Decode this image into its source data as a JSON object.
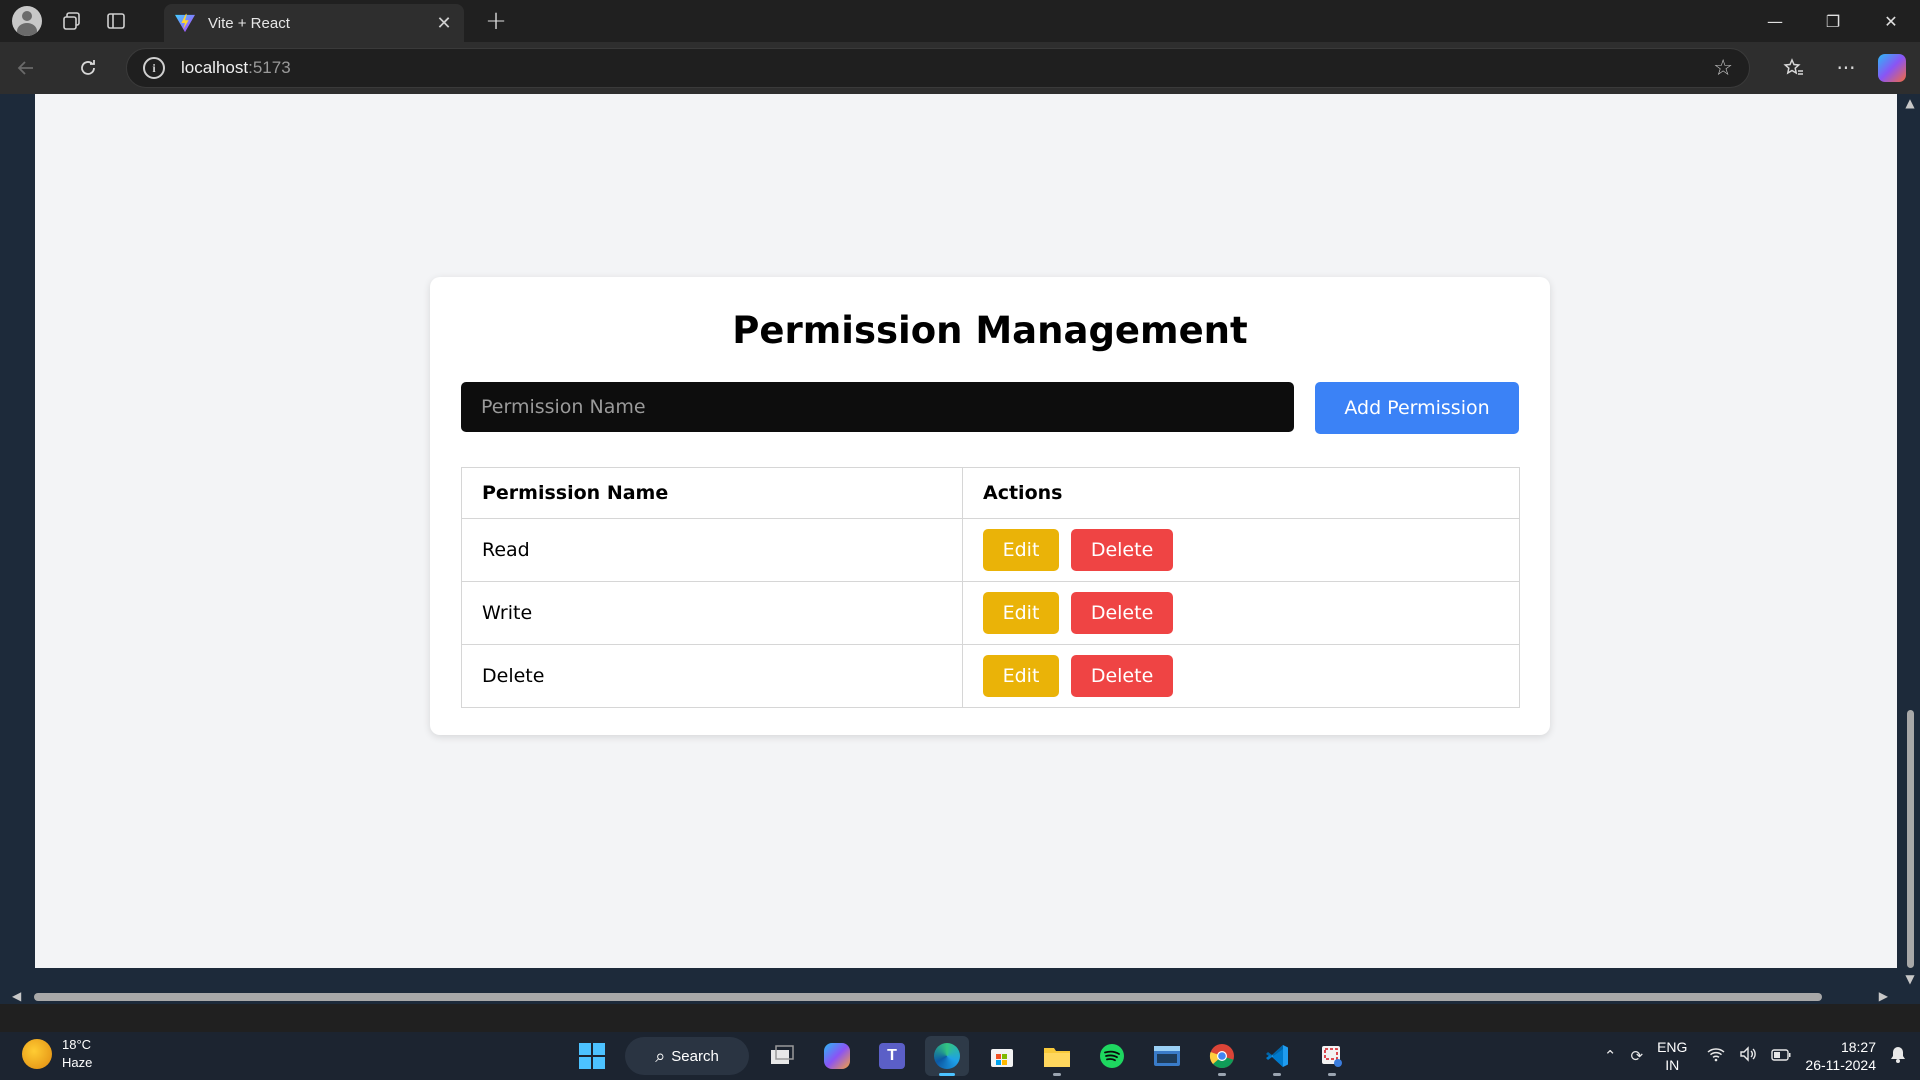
{
  "browser": {
    "tab_title": "Vite + React",
    "tab_close": "✕",
    "new_tab": "+",
    "url_host": "localhost",
    "url_port": ":5173",
    "window_controls": {
      "minimize": "—",
      "restore": "❐",
      "close": "✕"
    }
  },
  "app": {
    "title": "Permission Management",
    "input": {
      "placeholder": "Permission Name",
      "value": ""
    },
    "add_button": "Add Permission",
    "table": {
      "headers": [
        "Permission Name",
        "Actions"
      ],
      "rows": [
        {
          "name": "Read",
          "edit": "Edit",
          "delete": "Delete"
        },
        {
          "name": "Write",
          "edit": "Edit",
          "delete": "Delete"
        },
        {
          "name": "Delete",
          "edit": "Edit",
          "delete": "Delete"
        }
      ]
    },
    "colors": {
      "primary": "#3b82f6",
      "edit": "#eab308",
      "delete": "#ef4444",
      "input_bg": "#0d0d0d",
      "page_bg": "#f3f4f6"
    }
  },
  "taskbar": {
    "weather_temp": "18°C",
    "weather_desc": "Haze",
    "search_label": "Search",
    "lang_line1": "ENG",
    "lang_line2": "IN",
    "time": "18:27",
    "date": "26-11-2024",
    "pinned_icons": [
      "start-icon",
      "task-view-icon",
      "copilot-icon",
      "teams-icon",
      "edge-icon",
      "store-icon",
      "file-explorer-icon",
      "spotify-icon",
      "terminal-icon",
      "chrome-icon",
      "vscode-icon",
      "snipping-tool-icon"
    ]
  }
}
